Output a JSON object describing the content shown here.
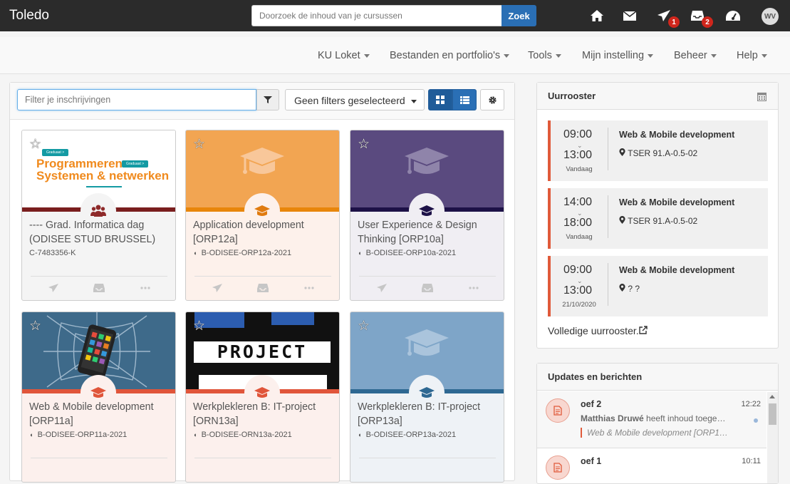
{
  "app": {
    "brand": "Toledo"
  },
  "search": {
    "placeholder": "Doorzoek de inhoud van je cursussen",
    "button": "Zoek"
  },
  "topicons": {
    "home": "home-icon",
    "mail": "mail-icon",
    "send": "send-icon",
    "send_badge": "1",
    "inbox": "inbox-icon",
    "inbox_badge": "2",
    "dashboard": "dashboard-icon",
    "avatar": "WV"
  },
  "menu": [
    "KU Loket",
    "Bestanden en portfolio's",
    "Tools",
    "Mijn instelling",
    "Beheer",
    "Help"
  ],
  "filter": {
    "placeholder": "Filter je inschrijvingen",
    "select": "Geen filters geselecteerd"
  },
  "courses": [
    {
      "title": "---- Grad. Informatica dag (ODISEE STUD BRUSSEL)",
      "code": "C-7483356-K",
      "hero_text": [
        "Programmeren",
        "Systemen & netwerken"
      ],
      "tag1": "Graduaat >",
      "tag2": "Graduaat >",
      "stripe": "#7a1e1e",
      "bg": "#f4f4f4",
      "icon": "users-icon"
    },
    {
      "title": "Application development [ORP12a]",
      "code": "B-ODISEE-ORP12a-2021",
      "stripe": "#e8860b",
      "bg": "#fdf1eb",
      "hero": "#f2a552",
      "icon": "graduation-cap-icon"
    },
    {
      "title": "User Experience & Design Thinking [ORP10a]",
      "code": "B-ODISEE-ORP10a-2021",
      "stripe": "#1d1147",
      "bg": "#f0eef3",
      "hero": "#5a4a7f",
      "icon": "graduation-cap-icon"
    },
    {
      "title": "Web & Mobile development [ORP11a]",
      "code": "B-ODISEE-ORP11a-2021",
      "stripe": "#e0553a",
      "bg": "#fcf0ed",
      "hero": "#3e6a8a",
      "icon": "graduation-cap-icon"
    },
    {
      "title": "Werkplekleren B: IT-project [ORN13a]",
      "code": "B-ODISEE-ORN13a-2021",
      "stripe": "#e0553a",
      "bg": "#fcf0ed",
      "hero": "#111111",
      "hero_text": "PROJECT",
      "icon": "graduation-cap-icon"
    },
    {
      "title": "Werkplekleren B: IT-project [ORP13a]",
      "code": "B-ODISEE-ORP13a-2021",
      "stripe": "#2e6892",
      "bg": "#eef2f6",
      "hero": "#7ea5c8",
      "icon": "graduation-cap-icon"
    }
  ],
  "schedule": {
    "title": "Uurrooster",
    "slots": [
      {
        "start": "09:00",
        "end": "13:00",
        "day": "Vandaag",
        "course": "Web & Mobile development",
        "location": "TSER 91.A-0.5-02"
      },
      {
        "start": "14:00",
        "end": "18:00",
        "day": "Vandaag",
        "course": "Web & Mobile development",
        "location": "TSER 91.A-0.5-02"
      },
      {
        "start": "09:00",
        "end": "13:00",
        "day": "21/10/2020",
        "course": "Web & Mobile development",
        "location": "? ?"
      }
    ],
    "full_link": "Volledige uurrooster."
  },
  "updates": {
    "title": "Updates en berichten",
    "items": [
      {
        "title": "oef 2",
        "time": "12:22",
        "by_name": "Matthias Druwé",
        "by_rest": " heeft inhoud toege…",
        "course": "Web & Mobile development [ORP1…"
      },
      {
        "title": "oef 1",
        "time": "10:11"
      }
    ]
  }
}
